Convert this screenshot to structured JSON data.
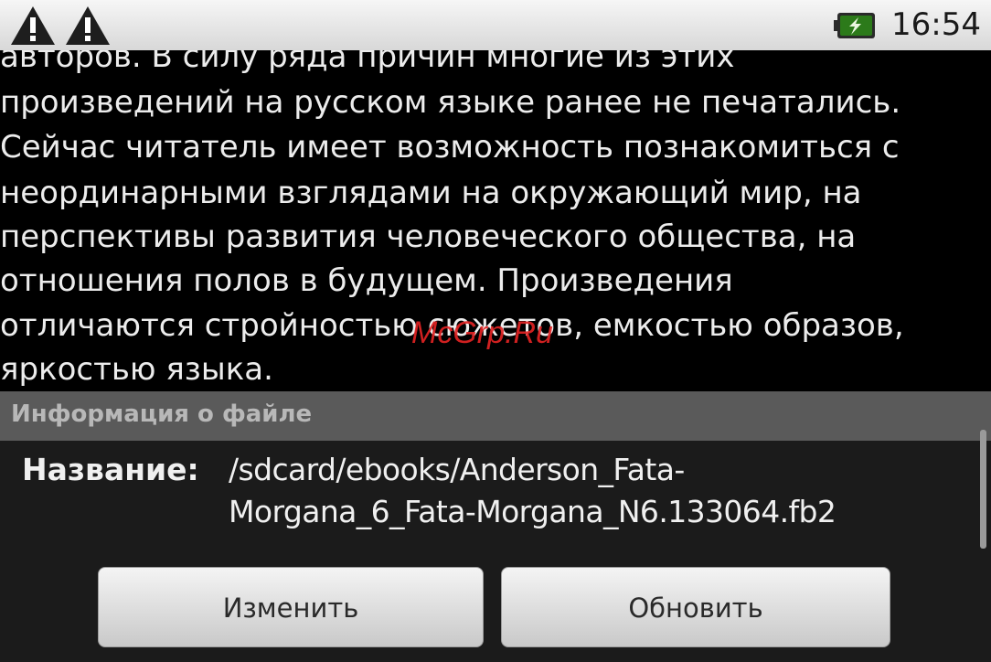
{
  "status_bar": {
    "icons": [
      "warning-icon",
      "warning-icon",
      "battery-charging-icon"
    ],
    "time": "16:54",
    "battery_color": "#2c7a1a"
  },
  "book_text": {
    "lines": [
      "авторов. В силу ряда причин многие из этих",
      "произведений на русском языке ранее не печатались.",
      "Сейчас читатель имеет возможность познакомиться с",
      "неординарными взглядами на окружающий мир, на",
      "перспективы развития человеческого общества, на",
      "отношения полов в будущем. Произведения",
      "отличаются стройностью сюжетов, емкостью образов,",
      "яркостью языка."
    ]
  },
  "watermark": "McGrp.Ru",
  "file_info": {
    "header": "Информация о файле",
    "name_label": "Название:",
    "name_value_lines": [
      "/sdcard/ebooks/Anderson_Fata-",
      "Morgana_6_Fata-Morgana_N6.133064.fb2"
    ]
  },
  "buttons": {
    "change": "Изменить",
    "refresh": "Обновить"
  },
  "colors": {
    "header_bg": "#5a5a5a",
    "watermark": "#e12323"
  }
}
